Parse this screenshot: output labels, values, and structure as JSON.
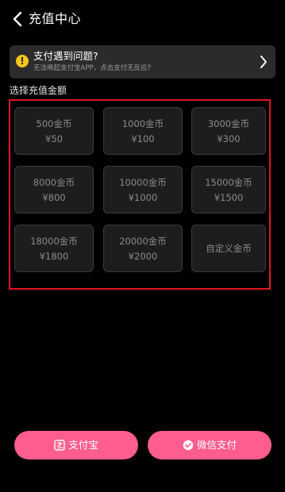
{
  "header": {
    "title": "充值中心"
  },
  "banner": {
    "title": "支付遇到问题?",
    "subtitle": "无法唤起支付宝APP，点击支付无反应?"
  },
  "section_label": "选择充值金额",
  "tiles": [
    {
      "coins": "500金币",
      "price": "¥50"
    },
    {
      "coins": "1000金币",
      "price": "¥100"
    },
    {
      "coins": "3000金币",
      "price": "¥300"
    },
    {
      "coins": "8000金币",
      "price": "¥800"
    },
    {
      "coins": "10000金币",
      "price": "¥1000"
    },
    {
      "coins": "15000金币",
      "price": "¥1500"
    },
    {
      "coins": "18000金币",
      "price": "¥1800"
    },
    {
      "coins": "20000金币",
      "price": "¥2000"
    }
  ],
  "custom_tile": {
    "label": "自定义金币"
  },
  "pay": {
    "alipay_label": "支付宝",
    "wechat_label": "微信支付"
  },
  "colors": {
    "background": "#000000",
    "accent_pink": "#ff5d8f",
    "warning_yellow": "#f5c518",
    "highlight_red": "#e0161e"
  }
}
